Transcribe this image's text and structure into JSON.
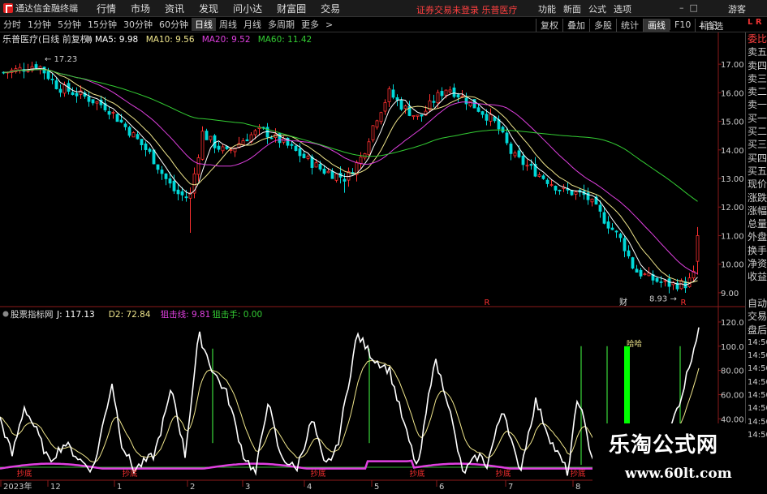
{
  "app": {
    "name": "通达信金融终端"
  },
  "menu": [
    "行情",
    "市场",
    "资讯",
    "发现",
    "问小达",
    "财富圈",
    "交易"
  ],
  "notice": "证券交易未登录  乐普医疗",
  "right_menu": [
    "功能",
    "新面",
    "公式",
    "选项"
  ],
  "guest": "游客",
  "periods": [
    "分时",
    "1分钟",
    "5分钟",
    "15分钟",
    "30分钟",
    "60分钟",
    "日线",
    "周线",
    "月线",
    "多周期",
    "更多"
  ],
  "active_period": "日线",
  "tools": [
    "复权",
    "叠加",
    "多股",
    "统计",
    "画线",
    "F10",
    "标记"
  ],
  "auto_select": "+自选",
  "lr": "L R",
  "main_chart": {
    "title": "乐普医疗(日线 前复权)",
    "ma": [
      {
        "label": "MA5: 9.98",
        "color": "#ffffff"
      },
      {
        "label": "MA10: 9.56",
        "color": "#f0e68c"
      },
      {
        "label": "MA20: 9.52",
        "color": "#e040e0"
      },
      {
        "label": "MA60: 11.42",
        "color": "#33cc33"
      }
    ],
    "price_axis": [
      "17.00",
      "16.00",
      "15.00",
      "14.00",
      "13.00",
      "12.00",
      "11.00",
      "10.00",
      "9.00"
    ],
    "high_label": "17.23",
    "low_label": "8.93",
    "markers": [
      "R",
      "财",
      "R"
    ]
  },
  "indicator": {
    "title": "股票指标网",
    "values": [
      {
        "label": "J: 117.13",
        "color": "#ffffff"
      },
      {
        "label": "D2: 72.84",
        "color": "#f0e68c"
      },
      {
        "label": "狙击线: 9.81",
        "color": "#e040e0"
      },
      {
        "label": "狙击手: 0.00",
        "color": "#33cc33"
      }
    ],
    "axis": [
      "120.0",
      "100.0",
      "80.00",
      "60.00",
      "40.00"
    ],
    "bottom_labels": [
      "抄底",
      "抄底",
      "抄底",
      "抄底",
      "抄底",
      "抄底"
    ],
    "signal_label": "哈哈"
  },
  "date_axis": [
    "2023年",
    "12",
    "1",
    "2",
    "3",
    "4",
    "5",
    "6",
    "7",
    "8"
  ],
  "side_panel": [
    "委比",
    "卖五",
    "卖四",
    "卖三",
    "卖二",
    "卖一",
    "买一",
    "买二",
    "买三",
    "买四",
    "买五",
    "现价",
    "涨跌",
    "涨幅",
    "总量",
    "外盘",
    "换手",
    "净资",
    "收益",
    "",
    "自动",
    "交易",
    "盘后",
    "14:50",
    "14:50",
    "14:50",
    "14:50",
    "14:50",
    "14:50",
    "14:50",
    "14:50"
  ],
  "watermark": {
    "title": "乐淘公式网",
    "url": "www.60lt.com"
  }
}
